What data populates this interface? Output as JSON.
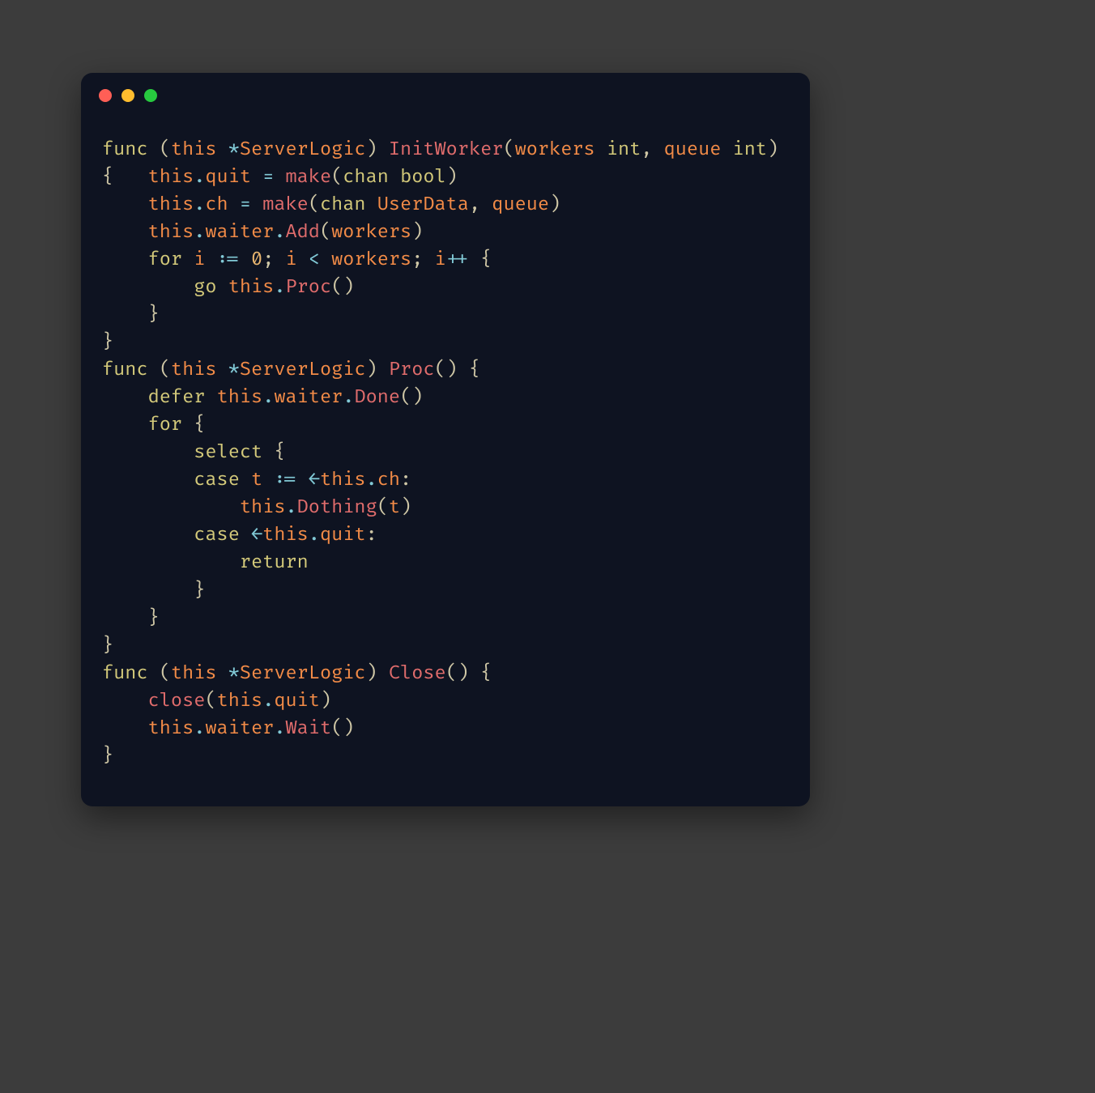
{
  "window": {
    "kind": "code-editor"
  },
  "code": {
    "language": "go",
    "tokens": [
      [
        [
          "kw",
          "func"
        ],
        [
          "pn",
          " ("
        ],
        [
          "id",
          "this"
        ],
        [
          "pn",
          " "
        ],
        [
          "op",
          "*"
        ],
        [
          "ty",
          "ServerLogic"
        ],
        [
          "pn",
          ") "
        ],
        [
          "fn",
          "InitWorker"
        ],
        [
          "pn",
          "("
        ],
        [
          "id",
          "workers"
        ],
        [
          "pn",
          " "
        ],
        [
          "kw",
          "int"
        ],
        [
          "pn",
          ", "
        ],
        [
          "id",
          "queue"
        ],
        [
          "pn",
          " "
        ],
        [
          "kw",
          "int"
        ],
        [
          "pn",
          ") "
        ]
      ],
      [
        [
          "pn",
          "{   "
        ],
        [
          "id",
          "this"
        ],
        [
          "op",
          "."
        ],
        [
          "id",
          "quit"
        ],
        [
          "pn",
          " "
        ],
        [
          "op",
          "="
        ],
        [
          "pn",
          " "
        ],
        [
          "fn",
          "make"
        ],
        [
          "pn",
          "("
        ],
        [
          "kw",
          "chan"
        ],
        [
          "pn",
          " "
        ],
        [
          "kw",
          "bool"
        ],
        [
          "pn",
          ")"
        ]
      ],
      [
        [
          "pn",
          "    "
        ],
        [
          "id",
          "this"
        ],
        [
          "op",
          "."
        ],
        [
          "id",
          "ch"
        ],
        [
          "pn",
          " "
        ],
        [
          "op",
          "="
        ],
        [
          "pn",
          " "
        ],
        [
          "fn",
          "make"
        ],
        [
          "pn",
          "("
        ],
        [
          "kw",
          "chan"
        ],
        [
          "pn",
          " "
        ],
        [
          "ty",
          "UserData"
        ],
        [
          "pn",
          ", "
        ],
        [
          "id",
          "queue"
        ],
        [
          "pn",
          ")"
        ]
      ],
      [
        [
          "pn",
          "    "
        ],
        [
          "id",
          "this"
        ],
        [
          "op",
          "."
        ],
        [
          "id",
          "waiter"
        ],
        [
          "op",
          "."
        ],
        [
          "fn",
          "Add"
        ],
        [
          "pn",
          "("
        ],
        [
          "id",
          "workers"
        ],
        [
          "pn",
          ")"
        ]
      ],
      [
        [
          "pn",
          "    "
        ],
        [
          "kw",
          "for"
        ],
        [
          "pn",
          " "
        ],
        [
          "id",
          "i"
        ],
        [
          "pn",
          " "
        ],
        [
          "op",
          ":="
        ],
        [
          "pn",
          " "
        ],
        [
          "num",
          "0"
        ],
        [
          "pn",
          "; "
        ],
        [
          "id",
          "i"
        ],
        [
          "pn",
          " "
        ],
        [
          "op",
          "<"
        ],
        [
          "pn",
          " "
        ],
        [
          "id",
          "workers"
        ],
        [
          "pn",
          "; "
        ],
        [
          "id",
          "i"
        ],
        [
          "op",
          "++"
        ],
        [
          "pn",
          " {"
        ]
      ],
      [
        [
          "pn",
          "        "
        ],
        [
          "kw",
          "go"
        ],
        [
          "pn",
          " "
        ],
        [
          "id",
          "this"
        ],
        [
          "op",
          "."
        ],
        [
          "fn",
          "Proc"
        ],
        [
          "pn",
          "()"
        ]
      ],
      [
        [
          "pn",
          "    }"
        ]
      ],
      [
        [
          "pn",
          "}"
        ]
      ],
      [
        [
          "kw",
          "func"
        ],
        [
          "pn",
          " ("
        ],
        [
          "id",
          "this"
        ],
        [
          "pn",
          " "
        ],
        [
          "op",
          "*"
        ],
        [
          "ty",
          "ServerLogic"
        ],
        [
          "pn",
          ") "
        ],
        [
          "fn",
          "Proc"
        ],
        [
          "pn",
          "() {"
        ]
      ],
      [
        [
          "pn",
          "    "
        ],
        [
          "kw",
          "defer"
        ],
        [
          "pn",
          " "
        ],
        [
          "id",
          "this"
        ],
        [
          "op",
          "."
        ],
        [
          "id",
          "waiter"
        ],
        [
          "op",
          "."
        ],
        [
          "fn",
          "Done"
        ],
        [
          "pn",
          "()"
        ]
      ],
      [
        [
          "pn",
          "    "
        ],
        [
          "kw",
          "for"
        ],
        [
          "pn",
          " {"
        ]
      ],
      [
        [
          "pn",
          "        "
        ],
        [
          "kw",
          "select"
        ],
        [
          "pn",
          " {"
        ]
      ],
      [
        [
          "pn",
          "        "
        ],
        [
          "kw",
          "case"
        ],
        [
          "pn",
          " "
        ],
        [
          "id",
          "t"
        ],
        [
          "pn",
          " "
        ],
        [
          "op",
          ":="
        ],
        [
          "pn",
          " "
        ],
        [
          "op",
          "←"
        ],
        [
          "id",
          "this"
        ],
        [
          "op",
          "."
        ],
        [
          "id",
          "ch"
        ],
        [
          "pn",
          ":"
        ]
      ],
      [
        [
          "pn",
          "            "
        ],
        [
          "id",
          "this"
        ],
        [
          "op",
          "."
        ],
        [
          "fn",
          "Dothing"
        ],
        [
          "pn",
          "("
        ],
        [
          "id",
          "t"
        ],
        [
          "pn",
          ")"
        ]
      ],
      [
        [
          "pn",
          "        "
        ],
        [
          "kw",
          "case"
        ],
        [
          "pn",
          " "
        ],
        [
          "op",
          "←"
        ],
        [
          "id",
          "this"
        ],
        [
          "op",
          "."
        ],
        [
          "id",
          "quit"
        ],
        [
          "pn",
          ":"
        ]
      ],
      [
        [
          "pn",
          "            "
        ],
        [
          "kw",
          "return"
        ]
      ],
      [
        [
          "pn",
          "        }"
        ]
      ],
      [
        [
          "pn",
          "    }"
        ]
      ],
      [
        [
          "pn",
          "}"
        ]
      ],
      [
        [
          "kw",
          "func"
        ],
        [
          "pn",
          " ("
        ],
        [
          "id",
          "this"
        ],
        [
          "pn",
          " "
        ],
        [
          "op",
          "*"
        ],
        [
          "ty",
          "ServerLogic"
        ],
        [
          "pn",
          ") "
        ],
        [
          "fn",
          "Close"
        ],
        [
          "pn",
          "() {"
        ]
      ],
      [
        [
          "pn",
          "    "
        ],
        [
          "fn",
          "close"
        ],
        [
          "pn",
          "("
        ],
        [
          "id",
          "this"
        ],
        [
          "op",
          "."
        ],
        [
          "id",
          "quit"
        ],
        [
          "pn",
          ")"
        ]
      ],
      [
        [
          "pn",
          "    "
        ],
        [
          "id",
          "this"
        ],
        [
          "op",
          "."
        ],
        [
          "id",
          "waiter"
        ],
        [
          "op",
          "."
        ],
        [
          "fn",
          "Wait"
        ],
        [
          "pn",
          "()"
        ]
      ],
      [
        [
          "pn",
          "}"
        ]
      ]
    ]
  }
}
